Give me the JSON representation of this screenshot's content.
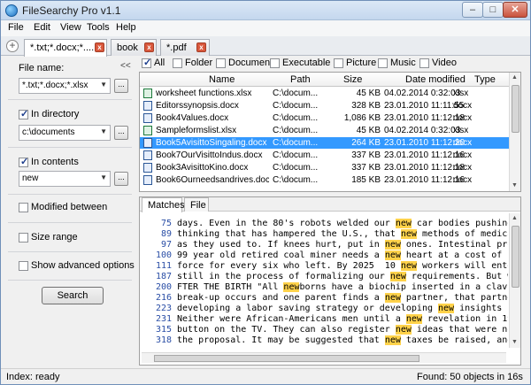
{
  "app": {
    "title": "FileSearchy Pro v1.1"
  },
  "menu": [
    "File",
    "Edit",
    "View",
    "Tools",
    "Help"
  ],
  "tabs": [
    "*.txt;*.docx;*....",
    "book",
    "*.pdf"
  ],
  "left": {
    "filename_label": "File name:",
    "filename_value": "*.txt;*.docx;*.xlsx",
    "in_directory_label": "In directory",
    "directory_value": "c:\\documents",
    "in_contents_label": "In contents",
    "contents_value": "new",
    "modified_between_label": "Modified between",
    "size_range_label": "Size range",
    "advanced_label": "Show advanced options",
    "search_button": "Search",
    "collapse_icon": "<<",
    "browse_label": "..."
  },
  "filters": {
    "all_label": "All",
    "items": [
      "Folder",
      "Document",
      "Executable",
      "Picture",
      "Music",
      "Video"
    ]
  },
  "columns": [
    "Name",
    "Path",
    "Size",
    "Date modified",
    "Type"
  ],
  "rows": [
    {
      "name": "worksheet functions.xlsx",
      "path": "C:\\docum...",
      "size": "45 KB",
      "date": "04.02.2014 0:32:03",
      "type": "xlsx",
      "icon": "xlsx"
    },
    {
      "name": "Editorssynopsis.docx",
      "path": "C:\\docum...",
      "size": "328 KB",
      "date": "23.01.2010 11:11:55",
      "type": "docx",
      "icon": "docx"
    },
    {
      "name": "Book4Values.docx",
      "path": "C:\\docum...",
      "size": "1,086 KB",
      "date": "23.01.2010 11:12:18",
      "type": "docx",
      "icon": "docx"
    },
    {
      "name": "Sampleformslist.xlsx",
      "path": "C:\\docum...",
      "size": "45 KB",
      "date": "04.02.2014 0:32:03",
      "type": "xlsx",
      "icon": "xlsx"
    },
    {
      "name": "Book5AvisittoSingaling.docx",
      "path": "C:\\docum...",
      "size": "264 KB",
      "date": "23.01.2010 11:12:20",
      "type": "docx",
      "icon": "docx",
      "selected": true
    },
    {
      "name": "Book7OurVisittoIndus.docx",
      "path": "C:\\docum...",
      "size": "337 KB",
      "date": "23.01.2010 11:12:16",
      "type": "docx",
      "icon": "docx"
    },
    {
      "name": "Book3AvisittoKino.docx",
      "path": "C:\\docum...",
      "size": "337 KB",
      "date": "23.01.2010 11:12:18",
      "type": "docx",
      "icon": "docx"
    },
    {
      "name": "Book6Ourneedsandrives.docx",
      "path": "C:\\docum...",
      "size": "185 KB",
      "date": "23.01.2010 11:12:16",
      "type": "docx",
      "icon": "docx"
    }
  ],
  "subtabs": [
    "Matches",
    "File"
  ],
  "matches": [
    {
      "ln": "75",
      "pre": "days. Even in the 80's robots welded our ",
      "hl": "new",
      "post": " car bodies pushing those"
    },
    {
      "ln": "89",
      "pre": "thinking that has hampered the U.S., that ",
      "hl": "new",
      "post": " methods of medical rese"
    },
    {
      "ln": "97",
      "pre": "as they used to. If knees hurt, put in ",
      "hl": "new",
      "post": " ones. Intestinal problems?"
    },
    {
      "ln": "100",
      "pre": "99 year old retired coal miner needs a ",
      "hl": "new",
      "post": " heart at a cost of $200,00"
    },
    {
      "ln": "111",
      "pre": "force for every six who left. By 2025  10 ",
      "hl": "new",
      "post": " workers will enter the"
    },
    {
      "ln": "187",
      "pre": "still in the process of formalizing our ",
      "hl": "new",
      "post": " requirements. But we put"
    },
    {
      "ln": "200",
      "pre": "FTER THE BIRTH \"All ",
      "hl": "new",
      "post": "borns have a biochip inserted in a clavicle. A"
    },
    {
      "ln": "216",
      "pre": "break-up occurs and one parent finds a ",
      "hl": "new",
      "post": " partner, that partner must"
    },
    {
      "ln": "223",
      "pre": "developing a labor saving strategy or developing ",
      "hl": "new",
      "post": " insights into pr"
    },
    {
      "ln": "231",
      "pre": "Neither were African-Americans men until a ",
      "hl": "new",
      "post": " revelation in 1978 all"
    },
    {
      "ln": "315",
      "pre": "button on the TV. They can also register ",
      "hl": "new",
      "post": " ideas that were not brou"
    },
    {
      "ln": "318",
      "pre": "the proposal. It may be suggested that ",
      "hl": "new",
      "post": " taxes be raised, and if so"
    }
  ],
  "status": {
    "left": "Index: ready",
    "right": "Found: 50 objects in 16s"
  }
}
